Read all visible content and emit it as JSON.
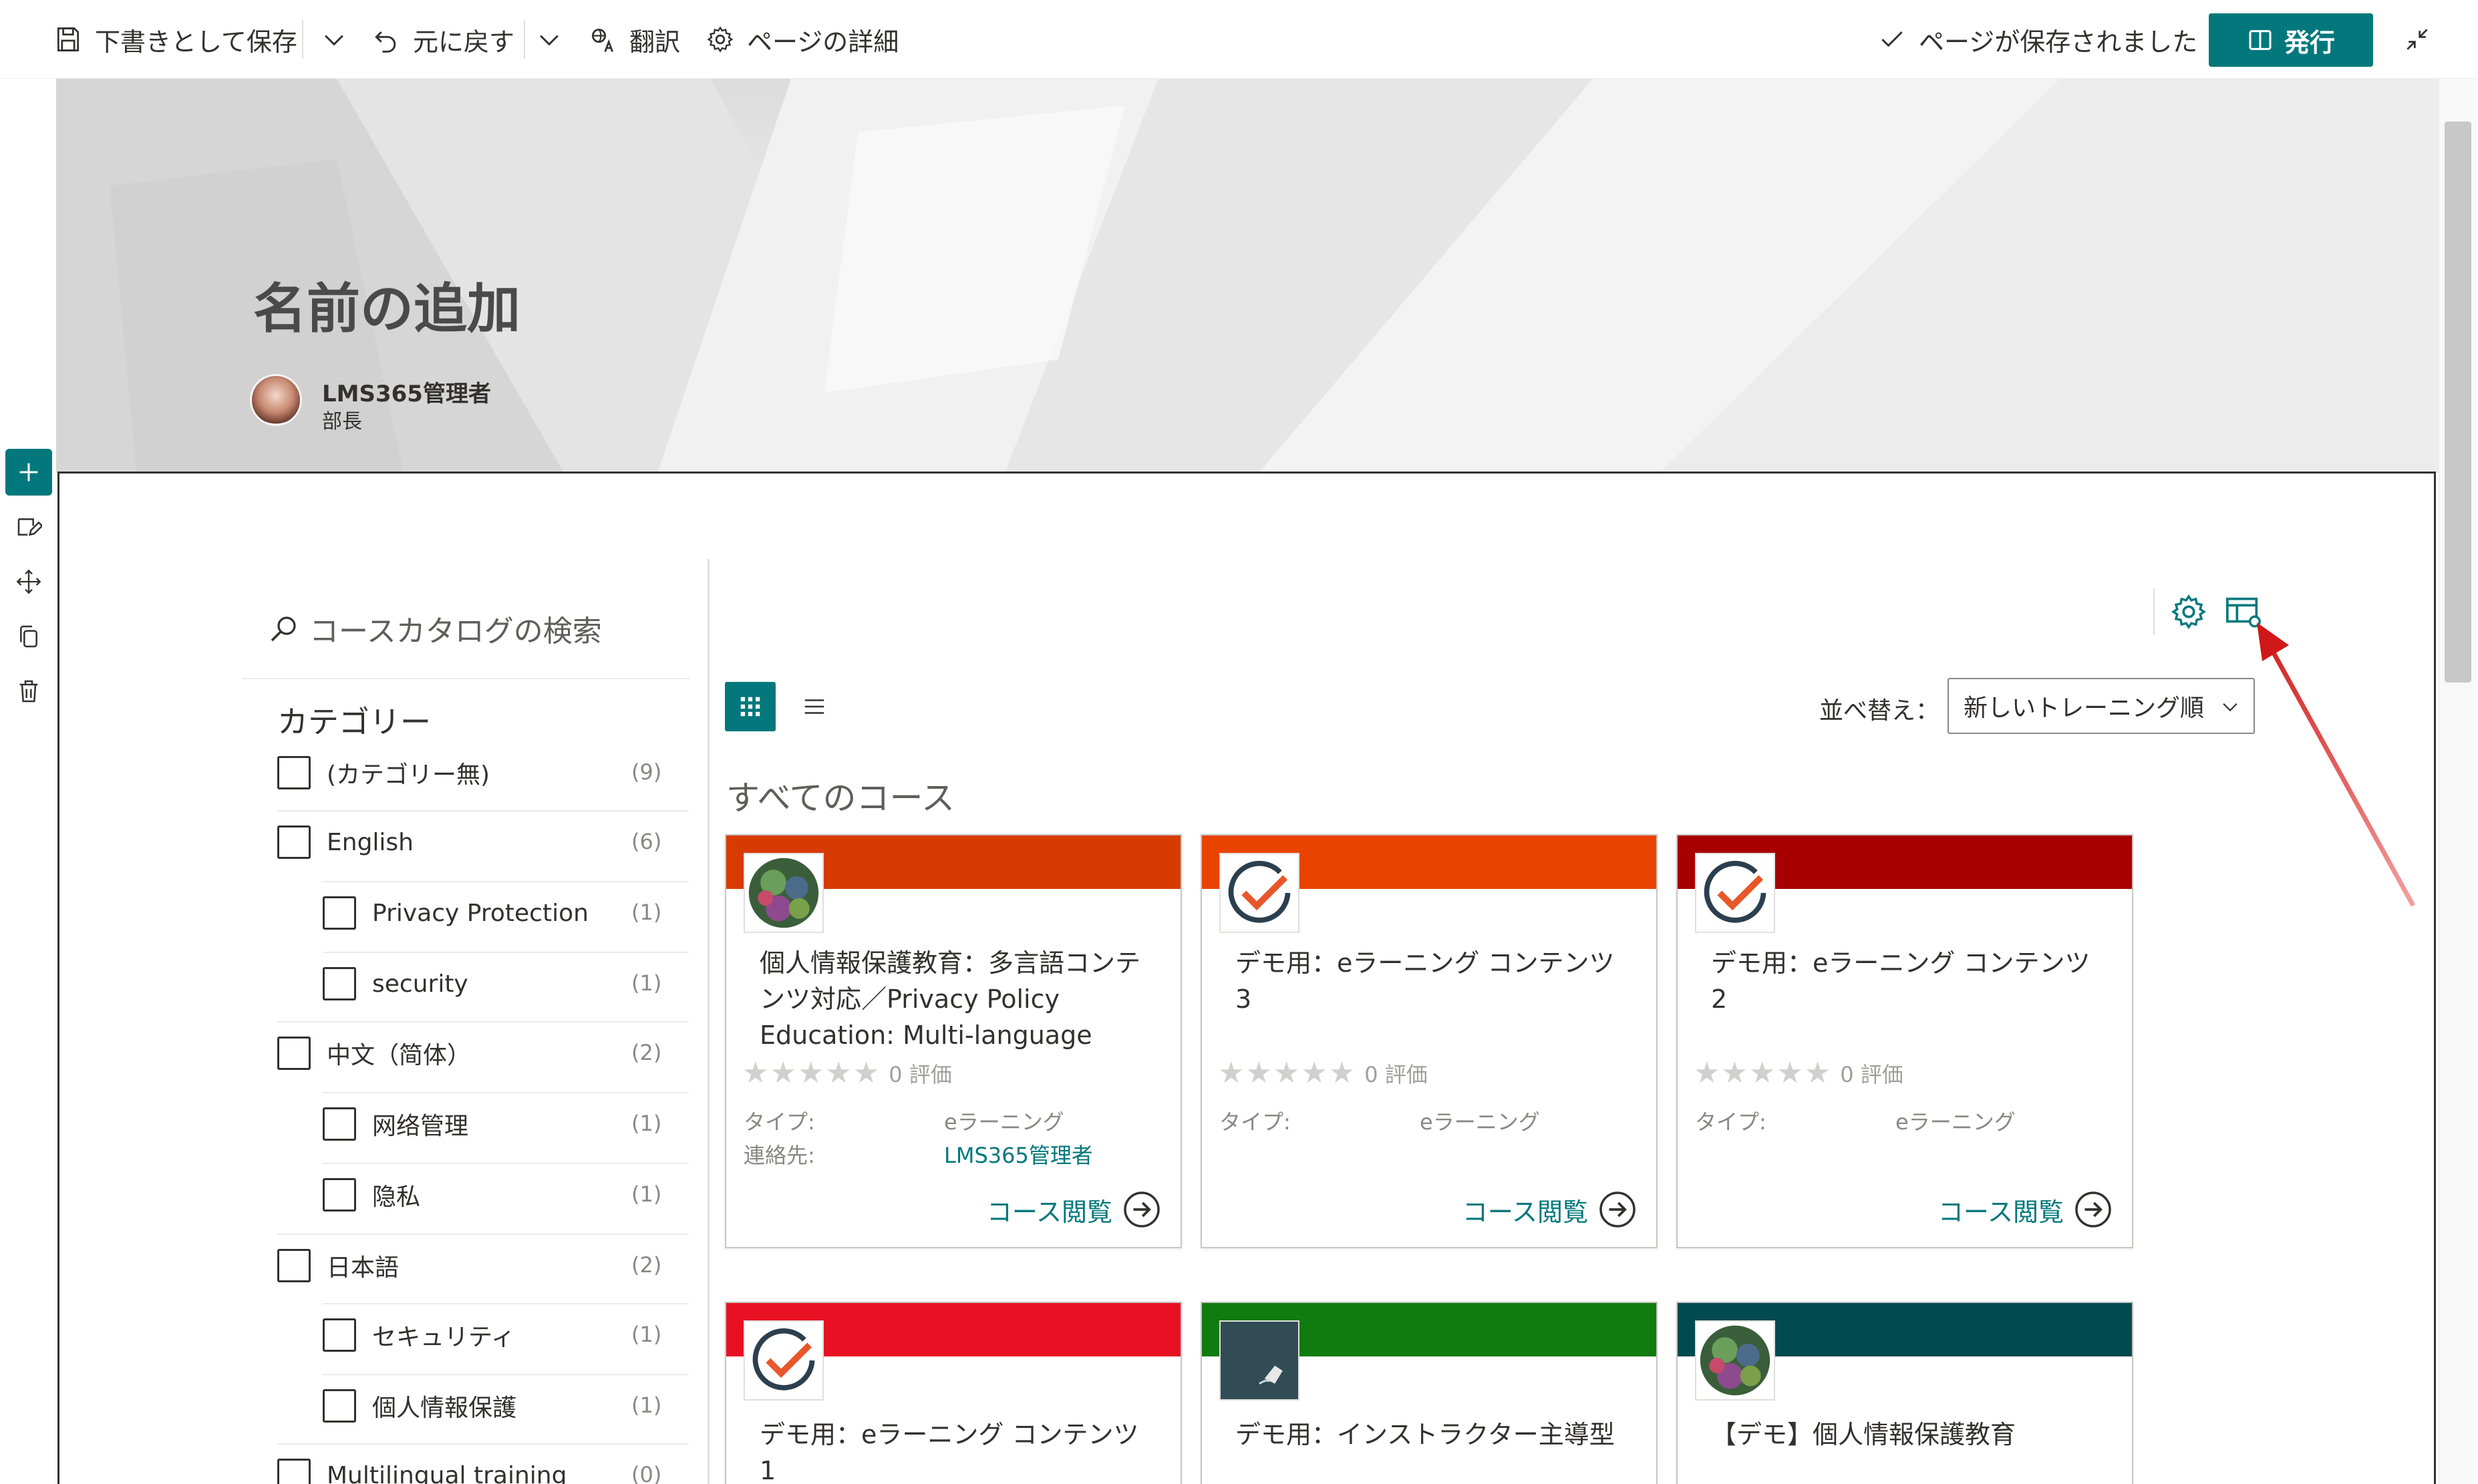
{
  "toolbar": {
    "save_draft": "下書きとして保存",
    "undo": "元に戻す",
    "translate": "翻訳",
    "page_details": "ページの詳細",
    "saved_status": "ページが保存されました",
    "publish": "発行"
  },
  "hero": {
    "title": "名前の追加",
    "author_name": "LMS365管理者",
    "author_role": "部長"
  },
  "catalog": {
    "search_placeholder": "コースカタログの検索",
    "category_heading": "カテゴリー",
    "categories": [
      {
        "label": "(カテゴリー無)",
        "count": "(9)",
        "indent": false
      },
      {
        "label": "English",
        "count": "(6)",
        "indent": false
      },
      {
        "label": "Privacy Protection",
        "count": "(1)",
        "indent": true
      },
      {
        "label": "security",
        "count": "(1)",
        "indent": true
      },
      {
        "label": "中文（简体）",
        "count": "(2)",
        "indent": false
      },
      {
        "label": "网络管理",
        "count": "(1)",
        "indent": true
      },
      {
        "label": "隐私",
        "count": "(1)",
        "indent": true
      },
      {
        "label": "日本語",
        "count": "(2)",
        "indent": false
      },
      {
        "label": "セキュリティ",
        "count": "(1)",
        "indent": true
      },
      {
        "label": "個人情報保護",
        "count": "(1)",
        "indent": true
      },
      {
        "label": "Multilingual training",
        "count": "(0)",
        "indent": false
      }
    ],
    "sort_label": "並べ替え：",
    "sort_value": "新しいトレーニング順",
    "all_courses": "すべてのコース",
    "cards": [
      {
        "title": "個人情報保護教育：多言語コンテンツ対応／Privacy Policy Education: Multi-language",
        "color": "#d83b01",
        "thumb": "globe",
        "stars": "★★★★★",
        "rating": "0 評価",
        "type_label": "タイプ:",
        "type_value": "eラーニング",
        "contact_label": "連絡先:",
        "contact_value": "LMS365管理者",
        "view": "コース閲覧"
      },
      {
        "title": "デモ用：eラーニング コンテンツ 3",
        "color": "#ea4300",
        "thumb": "check",
        "stars": "★★★★★",
        "rating": "0 評価",
        "type_label": "タイプ:",
        "type_value": "eラーニング",
        "view": "コース閲覧"
      },
      {
        "title": "デモ用：eラーニング コンテンツ 2",
        "color": "#a80000",
        "thumb": "check",
        "stars": "★★★★★",
        "rating": "0 評価",
        "type_label": "タイプ:",
        "type_value": "eラーニング",
        "view": "コース閲覧"
      },
      {
        "title": "デモ用：eラーニング コンテンツ 1",
        "color": "#e81123",
        "thumb": "check"
      },
      {
        "title": "デモ用：インストラクター主導型",
        "color": "#107c10",
        "thumb": "board"
      },
      {
        "title": "【デモ】個人情報保護教育",
        "color": "#004b50",
        "thumb": "globe"
      }
    ]
  },
  "colors": {
    "accent": "#03787c",
    "annotation_arrow": "#e02020"
  }
}
